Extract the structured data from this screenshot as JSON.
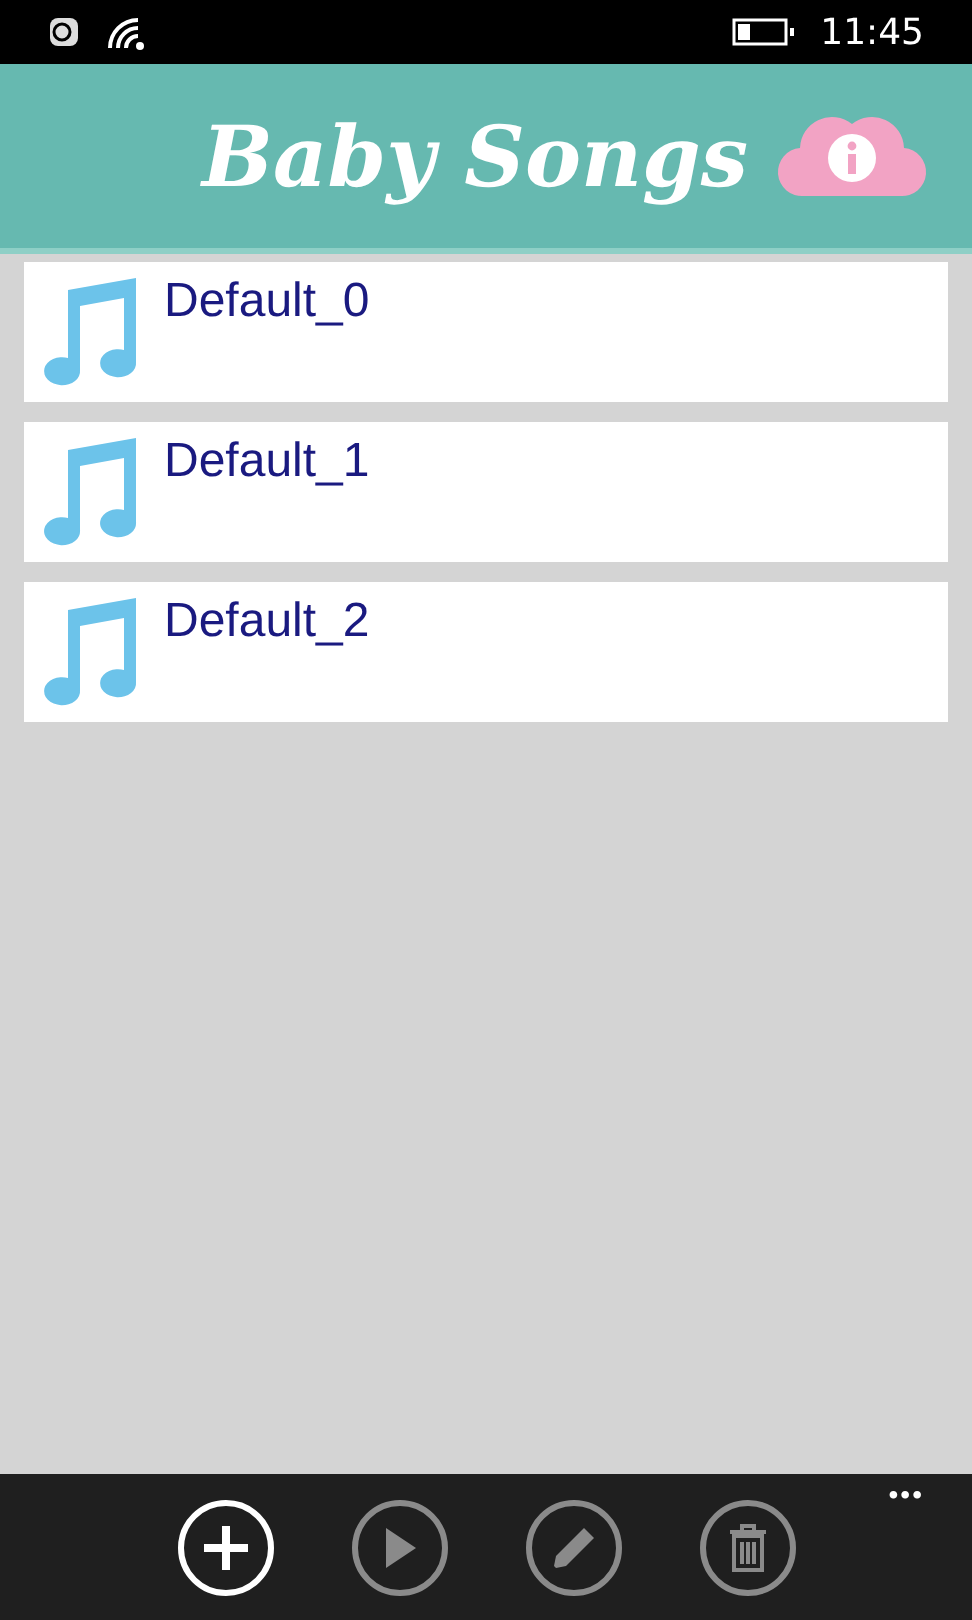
{
  "status_bar": {
    "time": "11:45"
  },
  "header": {
    "title": "Baby Songs"
  },
  "songs": [
    {
      "name": "Default_0"
    },
    {
      "name": "Default_1"
    },
    {
      "name": "Default_2"
    }
  ],
  "app_bar": {
    "buttons": [
      {
        "kind": "add",
        "disabled": false
      },
      {
        "kind": "play",
        "disabled": true
      },
      {
        "kind": "edit",
        "disabled": true
      },
      {
        "kind": "delete",
        "disabled": true
      }
    ],
    "more": "•••"
  }
}
